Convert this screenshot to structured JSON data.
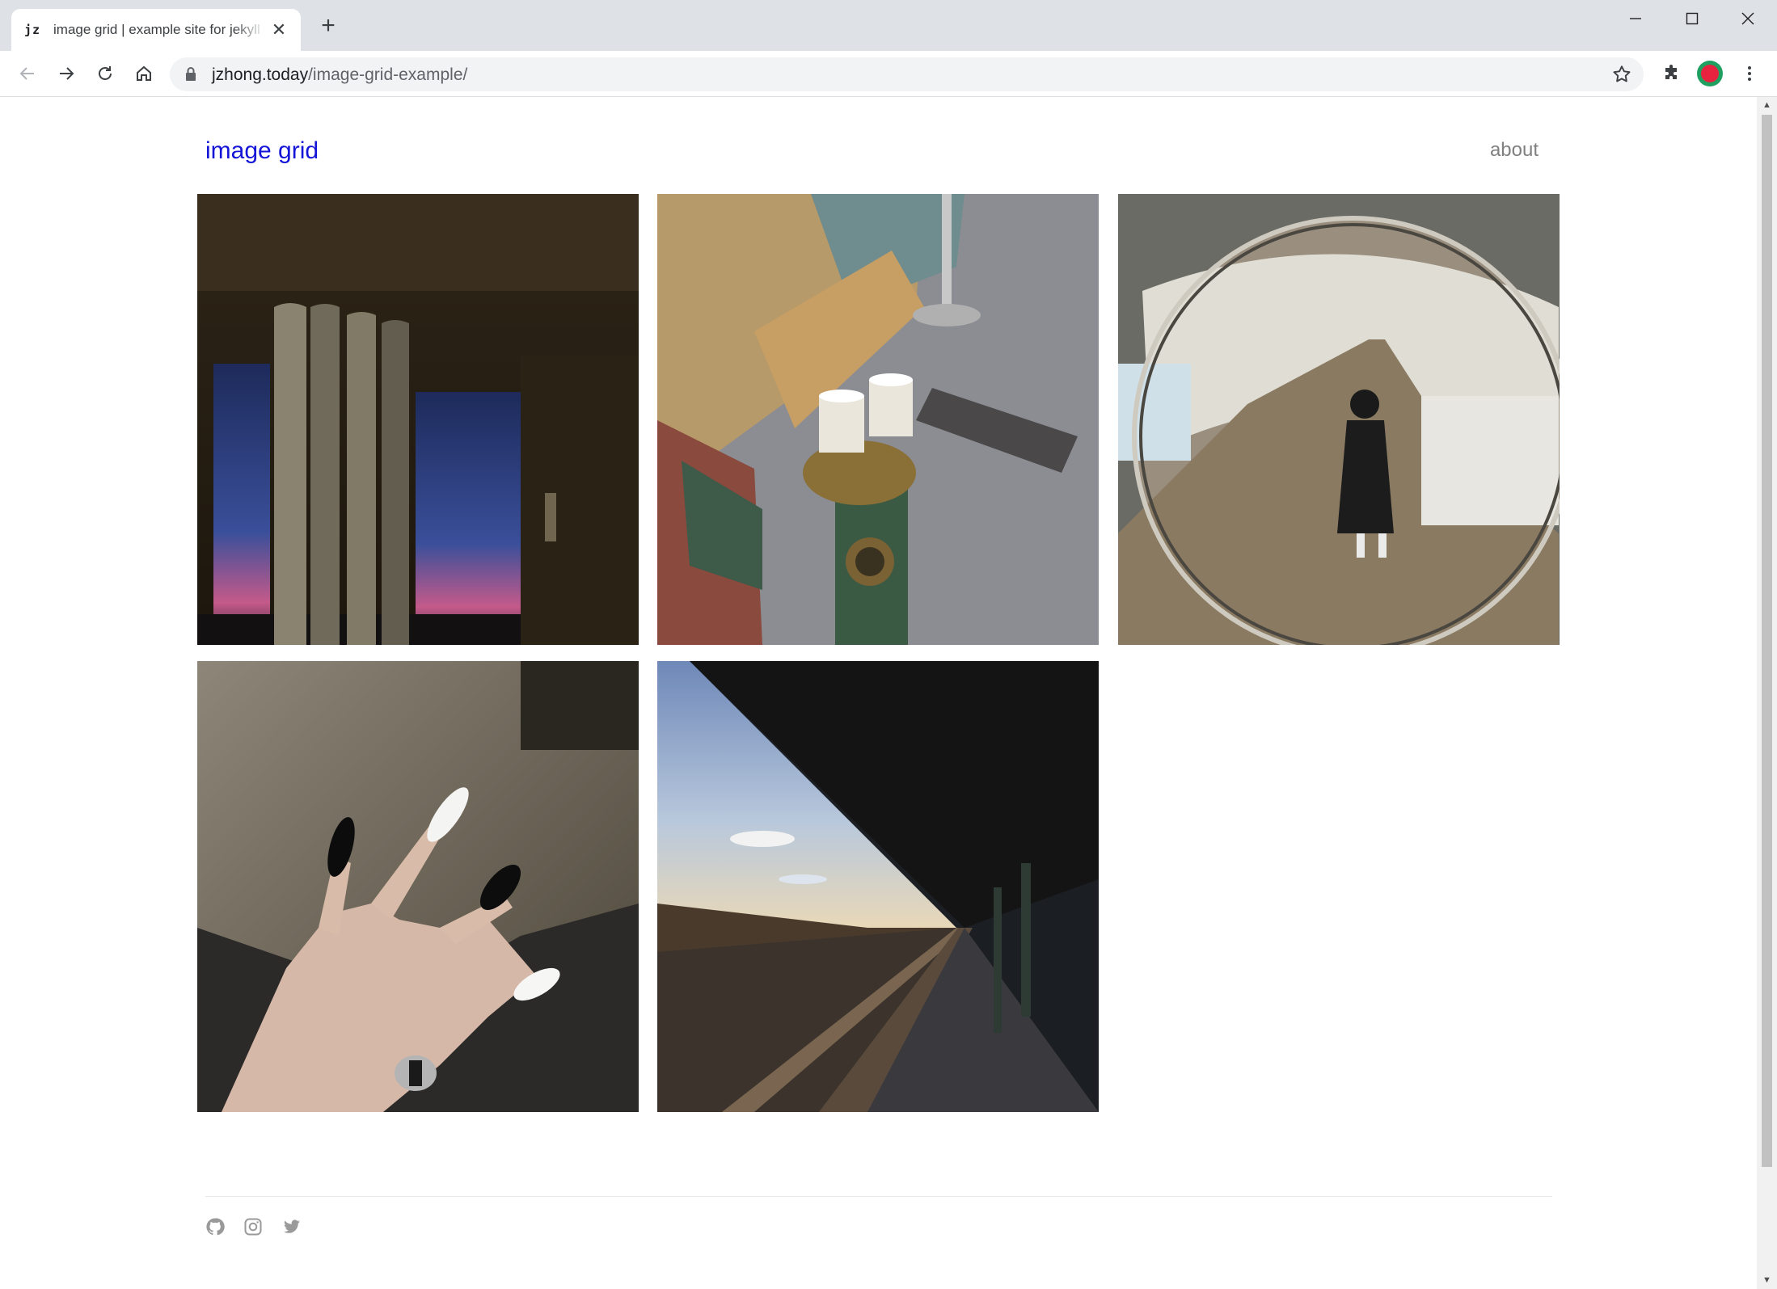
{
  "browser": {
    "tab_favicon": "jz",
    "tab_title": "image grid | example site for jekyll",
    "tab_close": "✕",
    "new_tab": "+",
    "url_domain": "jzhong.today",
    "url_path": "/image-grid-example/"
  },
  "header": {
    "site_title": "image grid",
    "nav_about": "about"
  },
  "grid": {
    "images": [
      {
        "name": "window-sunset-photo",
        "icon": "window-curtain"
      },
      {
        "name": "fire-hydrant-cups-photo",
        "icon": "fire-hydrant"
      },
      {
        "name": "subway-mirror-photo",
        "icon": "convex-mirror"
      },
      {
        "name": "painted-nails-photo",
        "icon": "hand-nails"
      },
      {
        "name": "elevated-train-platform-photo",
        "icon": "train-platform"
      }
    ]
  },
  "footer": {
    "icons": [
      "github-icon",
      "instagram-icon",
      "twitter-icon"
    ]
  },
  "colors": {
    "link_blue": "#1515d8",
    "nav_gray": "#808080",
    "chrome_gray": "#dee1e6"
  }
}
